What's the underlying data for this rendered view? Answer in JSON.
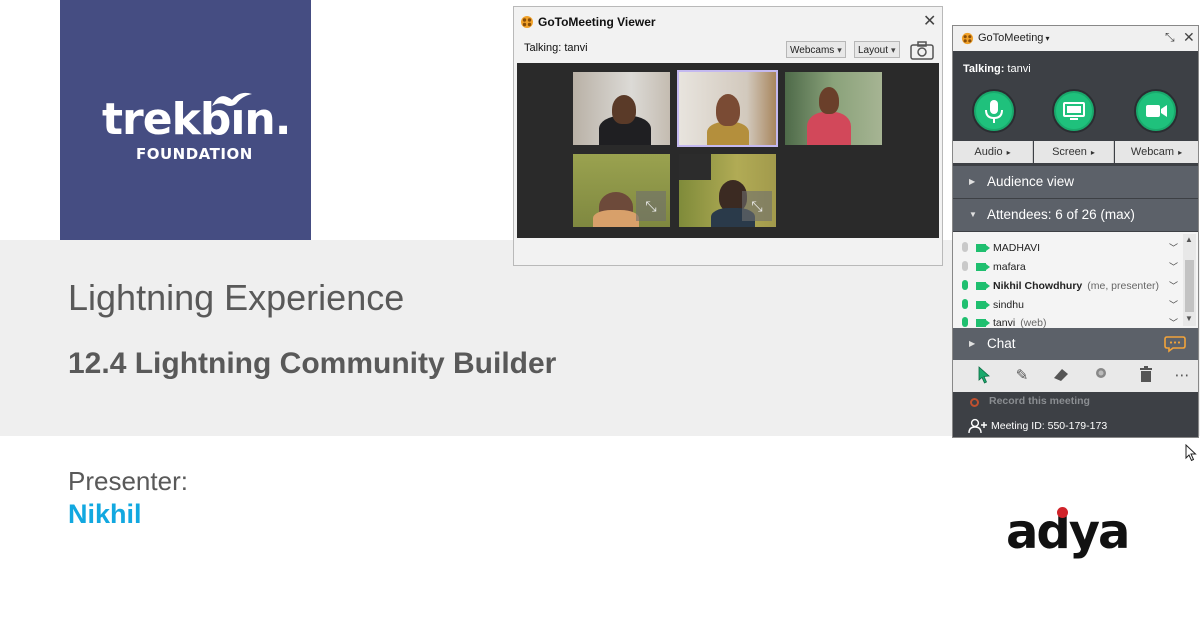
{
  "slide": {
    "logo_text": "trekbın.",
    "logo_sub": "FOUNDATION",
    "title": "Lightning Experience",
    "subtitle": "12.4 Lightning Community Builder",
    "presenter_label": "Presenter:",
    "presenter_name": "Nikhil",
    "partner_logo": "adya",
    "colors": {
      "logo_bg": "#454d82",
      "band": "#efefef",
      "presenter_name": "#12a8e0",
      "adya_dot": "#d0232a"
    }
  },
  "viewer": {
    "title": "GoToMeeting Viewer",
    "talking": "Talking: tanvi",
    "webcams_label": "Webcams",
    "layout_label": "Layout",
    "icons": {
      "close": "close-icon",
      "snapshot": "camera-icon",
      "expand": "expand-icon"
    },
    "tiles": 5,
    "active_tile": 2
  },
  "gtm": {
    "brand": "GoToMeeting",
    "talking_label": "Talking:",
    "talking_name": "tanvi",
    "controls": [
      {
        "label": "Audio",
        "icon": "microphone-icon"
      },
      {
        "label": "Screen",
        "icon": "monitor-icon"
      },
      {
        "label": "Webcam",
        "icon": "video-camera-icon"
      }
    ],
    "audience_view": "Audience view",
    "attendees_label": "Attendees:  6 of 26 (max)",
    "attendees": [
      {
        "name": "MADHAVI",
        "note": "",
        "bold": false,
        "mic_active": false
      },
      {
        "name": "mafara",
        "note": "",
        "bold": false,
        "mic_active": false
      },
      {
        "name": "Nikhil Chowdhury",
        "note": "(me, presenter)",
        "bold": true,
        "mic_active": true
      },
      {
        "name": "sindhu",
        "note": "",
        "bold": false,
        "mic_active": true
      },
      {
        "name": "tanvi",
        "note": "(web)",
        "bold": false,
        "mic_active": true
      }
    ],
    "chat": "Chat",
    "record": "Record this meeting",
    "meeting_id": "Meeting ID: 550-179-173",
    "colors": {
      "accent": "#1fc17c",
      "panel_bg": "#3d4045",
      "section_bg": "#5c6169"
    }
  }
}
